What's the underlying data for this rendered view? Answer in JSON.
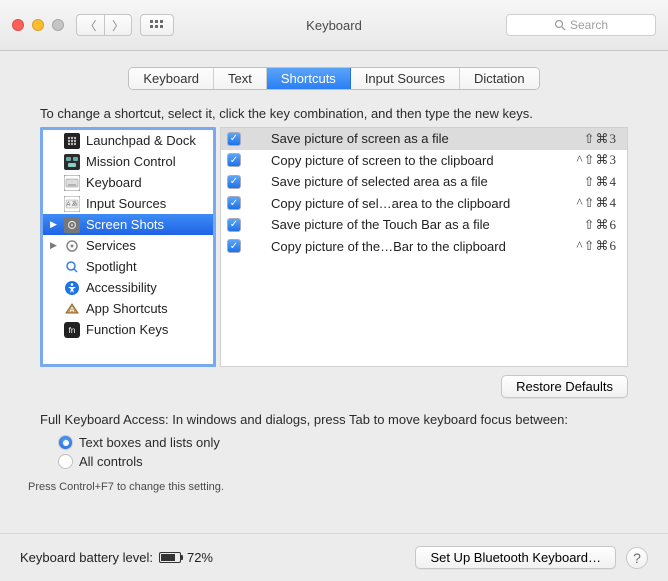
{
  "window": {
    "title": "Keyboard"
  },
  "search": {
    "placeholder": "Search"
  },
  "tabs": [
    "Keyboard",
    "Text",
    "Shortcuts",
    "Input Sources",
    "Dictation"
  ],
  "tabs_selected": 2,
  "intro": "To change a shortcut, select it, click the key combination, and then type the new keys.",
  "categories": [
    {
      "label": "Launchpad & Dock",
      "icon": "launchpad",
      "bg": "#222",
      "fg": "#fff"
    },
    {
      "label": "Mission Control",
      "icon": "mission",
      "bg": "#2c2c2c",
      "fg": "#cfe"
    },
    {
      "label": "Keyboard",
      "icon": "keyboard",
      "bg": "#555",
      "fg": "#fff"
    },
    {
      "label": "Input Sources",
      "icon": "input",
      "bg": "#777",
      "fg": "#fff"
    },
    {
      "label": "Screen Shots",
      "icon": "gear",
      "bg": "#777",
      "fg": "#fff",
      "selected": true
    },
    {
      "label": "Services",
      "icon": "gear2",
      "bg": "#888",
      "fg": "#fff",
      "haschild": true
    },
    {
      "label": "Spotlight",
      "icon": "spotlight",
      "bg": "#fff",
      "fg": "#3a7de0"
    },
    {
      "label": "Accessibility",
      "icon": "access",
      "bg": "#1e74e6",
      "fg": "#fff"
    },
    {
      "label": "App Shortcuts",
      "icon": "apps",
      "bg": "#b8863a",
      "fg": "#fff"
    },
    {
      "label": "Function Keys",
      "icon": "fn",
      "bg": "#222",
      "fg": "#fff"
    }
  ],
  "shortcuts": [
    {
      "enabled": true,
      "selected": true,
      "label": "Save picture of screen as a file",
      "keys": "⇧⌘3"
    },
    {
      "enabled": true,
      "label": "Copy picture of screen to the clipboard",
      "keys": "^⇧⌘3"
    },
    {
      "enabled": true,
      "label": "Save picture of selected area as a file",
      "keys": "⇧⌘4"
    },
    {
      "enabled": true,
      "label": "Copy picture of sel…area to the clipboard",
      "keys": "^⇧⌘4"
    },
    {
      "enabled": true,
      "label": "Save picture of the Touch Bar as a file",
      "keys": "⇧⌘6"
    },
    {
      "enabled": true,
      "label": "Copy picture of the…Bar to the clipboard",
      "keys": "^⇧⌘6"
    }
  ],
  "restore_label": "Restore Defaults",
  "fkaccess": {
    "text": "Full Keyboard Access: In windows and dialogs, press Tab to move keyboard focus between:",
    "options": [
      "Text boxes and lists only",
      "All controls"
    ],
    "selected": 0,
    "hint": "Press Control+F7 to change this setting."
  },
  "footer": {
    "battery_label": "Keyboard battery level:",
    "battery_pct": "72%",
    "bt_button": "Set Up Bluetooth Keyboard…"
  }
}
